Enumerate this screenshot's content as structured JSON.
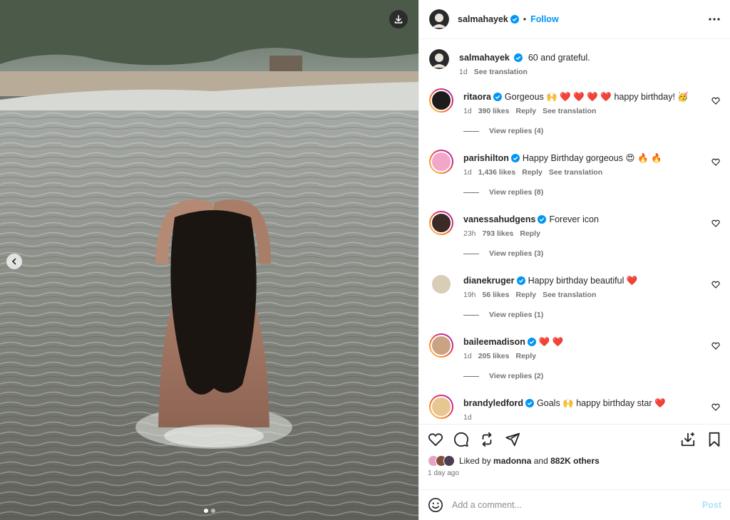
{
  "colors": {
    "link": "#0095f6",
    "heart": "#ff3040",
    "muted": "#737373",
    "post_disabled": "#b2dffc"
  },
  "post": {
    "author": "salmahayek",
    "follow_label": "Follow",
    "separator": "•",
    "caption_text": "60 and grateful.",
    "caption_time": "1d",
    "see_translation": "See translation",
    "carousel": {
      "slides": 2,
      "active_index": 0
    }
  },
  "comments": [
    {
      "user": "ritaora",
      "text": "Gorgeous 🙌 ❤️ ❤️ ❤️ ❤️ happy birthday! 🥳",
      "time": "1d",
      "likes": "390 likes",
      "reply": "Reply",
      "translation": "See translation",
      "replies": "View replies (4)",
      "avatar_bg": "#1c1c1c",
      "ring": true
    },
    {
      "user": "parishilton",
      "text": "Happy Birthday gorgeous 😍 🔥 🔥",
      "time": "1d",
      "likes": "1,436 likes",
      "reply": "Reply",
      "translation": "See translation",
      "replies": "View replies (8)",
      "avatar_bg": "#f2a7c8",
      "ring": true
    },
    {
      "user": "vanessahudgens",
      "text": "Forever icon",
      "time": "23h",
      "likes": "793 likes",
      "reply": "Reply",
      "translation": "",
      "replies": "View replies (3)",
      "avatar_bg": "#3b2a25",
      "ring": true
    },
    {
      "user": "dianekruger",
      "text": "Happy birthday beautiful ❤️",
      "time": "19h",
      "likes": "56 likes",
      "reply": "Reply",
      "translation": "See translation",
      "replies": "View replies (1)",
      "avatar_bg": "#d9cdb8",
      "ring": false
    },
    {
      "user": "baileemadison",
      "text": "❤️ ❤️",
      "time": "1d",
      "likes": "205 likes",
      "reply": "Reply",
      "translation": "",
      "replies": "View replies (2)",
      "avatar_bg": "#c9a383",
      "ring": true
    },
    {
      "user": "brandyledford",
      "text": "Goals 🙌 happy birthday star ❤️",
      "time": "1d",
      "likes": "",
      "reply": "",
      "translation": "",
      "replies": "",
      "avatar_bg": "#e8c68f",
      "ring": true
    }
  ],
  "likes": {
    "prefix": "Liked by",
    "user": "madonna",
    "conj": "and",
    "others": "882K others",
    "time_ago": "1 day ago"
  },
  "composer": {
    "placeholder": "Add a comment...",
    "post_label": "Post"
  },
  "icons": {
    "download": "download-icon",
    "prev": "chevron-left-icon",
    "verified": "verified-badge-icon",
    "more": "more-horizontal-icon",
    "heart": "heart-icon",
    "comment": "comment-icon",
    "repost": "repost-icon",
    "share": "share-icon",
    "save": "bookmark-icon",
    "collab": "add-to-collection-icon",
    "emoji": "emoji-icon"
  }
}
